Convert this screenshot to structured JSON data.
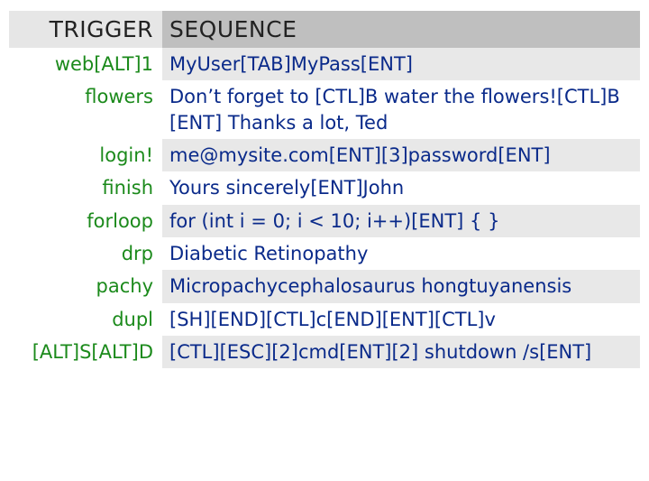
{
  "headers": {
    "trigger": "TRIGGER",
    "sequence": "SEQUENCE"
  },
  "rows": [
    {
      "trigger": "web[ALT]1",
      "sequence": "MyUser[TAB]MyPass[ENT]"
    },
    {
      "trigger": "flowers",
      "sequence": "Don’t forget to [CTL]B water the flowers![CTL]B [ENT] Thanks a lot, Ted"
    },
    {
      "trigger": "login!",
      "sequence": "me@mysite.com[ENT][3]password[ENT]"
    },
    {
      "trigger": "finish",
      "sequence": "Yours sincerely[ENT]John"
    },
    {
      "trigger": "forloop",
      "sequence": "for (int i = 0; i < 10; i++)[ENT] { }"
    },
    {
      "trigger": "drp",
      "sequence": "Diabetic Retinopathy"
    },
    {
      "trigger": "pachy",
      "sequence": "Micropachycephalosaurus hongtuyanensis"
    },
    {
      "trigger": "dupl",
      "sequence": "[SH][END][CTL]c[END][ENT][CTL]v"
    },
    {
      "trigger": "[ALT]S[ALT]D",
      "sequence": "[CTL][ESC][2]cmd[ENT][2] shutdown /s[ENT]"
    }
  ]
}
